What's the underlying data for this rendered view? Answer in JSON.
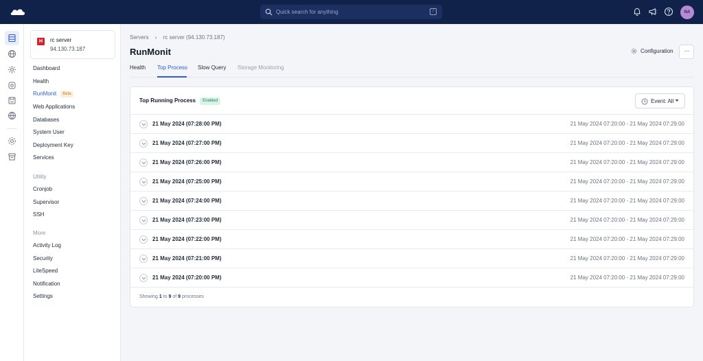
{
  "topbar": {
    "search_placeholder": "Quick search for anything",
    "search_shortcut": "/",
    "avatar_initials": "NA"
  },
  "server": {
    "badge": "H",
    "name": "rc server",
    "ip": "94.130.73.187"
  },
  "sidebar": {
    "items": [
      {
        "label": "Dashboard"
      },
      {
        "label": "Health"
      },
      {
        "label": "RunMonit",
        "badge": "Beta",
        "active": true
      },
      {
        "label": "Web Applications"
      },
      {
        "label": "Databases"
      },
      {
        "label": "System User"
      },
      {
        "label": "Deployment Key"
      },
      {
        "label": "Services"
      }
    ],
    "utility_heading": "Utility",
    "utility_items": [
      {
        "label": "Cronjob"
      },
      {
        "label": "Supervisor"
      },
      {
        "label": "SSH"
      }
    ],
    "more_heading": "More",
    "more_items": [
      {
        "label": "Activity Log"
      },
      {
        "label": "Security"
      },
      {
        "label": "LiteSpeed"
      },
      {
        "label": "Notification"
      },
      {
        "label": "Settings"
      }
    ]
  },
  "breadcrumb": {
    "root": "Servers",
    "current": "rc server (94.130.73.187)"
  },
  "page": {
    "title": "RunMonit",
    "config_label": "Configuration",
    "more_label": "···"
  },
  "tabs": [
    {
      "label": "Health"
    },
    {
      "label": "Top Process",
      "active": true
    },
    {
      "label": "Slow Query"
    },
    {
      "label": "Storage Monitoring"
    }
  ],
  "panel": {
    "title": "Top Running Process",
    "status": "Enabled",
    "event_filter": "Event: All",
    "rows": [
      {
        "time": "21 May 2024 (07:28:00 PM)",
        "range": "21 May 2024 07:20:00 - 21 May 2024 07:29:00"
      },
      {
        "time": "21 May 2024 (07:27:00 PM)",
        "range": "21 May 2024 07:20:00 - 21 May 2024 07:29:00"
      },
      {
        "time": "21 May 2024 (07:26:00 PM)",
        "range": "21 May 2024 07:20:00 - 21 May 2024 07:29:00"
      },
      {
        "time": "21 May 2024 (07:25:00 PM)",
        "range": "21 May 2024 07:20:00 - 21 May 2024 07:29:00"
      },
      {
        "time": "21 May 2024 (07:24:00 PM)",
        "range": "21 May 2024 07:20:00 - 21 May 2024 07:29:00"
      },
      {
        "time": "21 May 2024 (07:23:00 PM)",
        "range": "21 May 2024 07:20:00 - 21 May 2024 07:29:00"
      },
      {
        "time": "21 May 2024 (07:22:00 PM)",
        "range": "21 May 2024 07:20:00 - 21 May 2024 07:29:00"
      },
      {
        "time": "21 May 2024 (07:21:00 PM)",
        "range": "21 May 2024 07:20:00 - 21 May 2024 07:29:00"
      },
      {
        "time": "21 May 2024 (07:20:00 PM)",
        "range": "21 May 2024 07:20:00 - 21 May 2024 07:29:00"
      }
    ],
    "footer": {
      "prefix": "Showing",
      "from": "1",
      "to_word": "to",
      "to": "9",
      "of_word": "of",
      "total": "9",
      "suffix": "processes"
    }
  },
  "colors": {
    "topbar": "#11224a",
    "accent": "#2f5bd3",
    "brand_red": "#d5202e",
    "enabled_green": "#12885a"
  },
  "icons": {
    "rail": [
      "servers-icon",
      "globe-icon",
      "settings-gear-icon",
      "integration-icon",
      "storage-icon",
      "network-icon",
      "preferences-icon",
      "archive-icon"
    ],
    "topbar": [
      "bell-icon",
      "megaphone-icon",
      "help-icon"
    ]
  }
}
